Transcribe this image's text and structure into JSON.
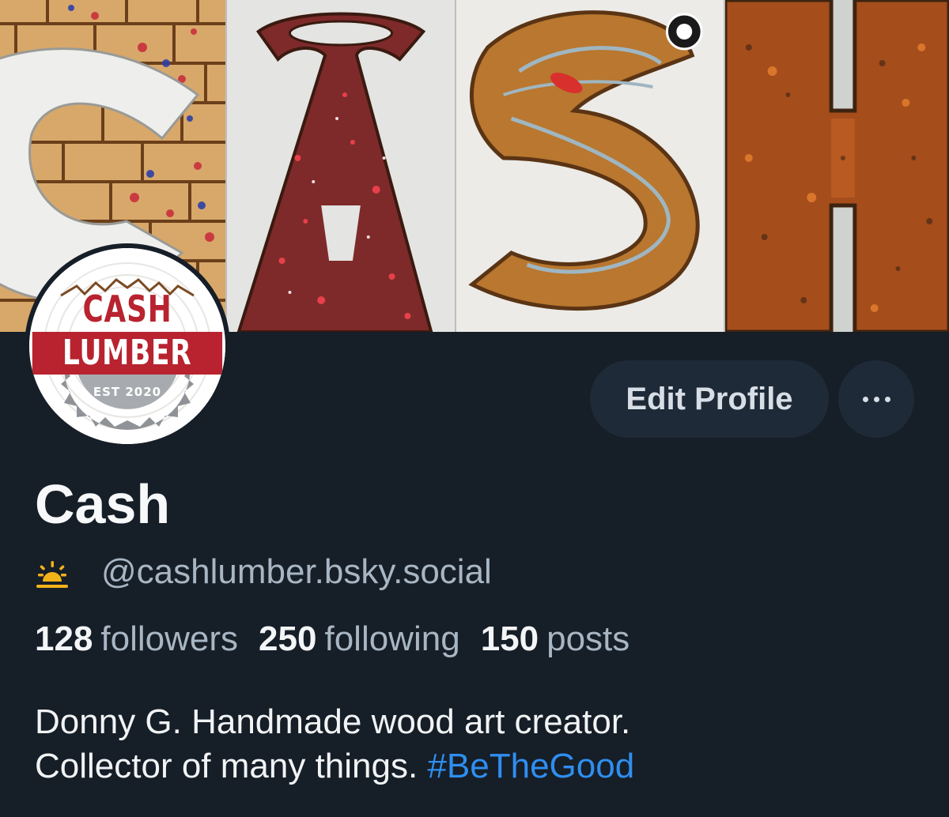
{
  "banner": {
    "letters": [
      "C",
      "A",
      "S",
      "H"
    ]
  },
  "avatar": {
    "line1": "CASH",
    "line2": "LUMBER",
    "line3": "EST 2020"
  },
  "actions": {
    "edit_label": "Edit Profile",
    "more_icon": "ellipsis-icon"
  },
  "profile": {
    "display_name": "Cash",
    "handle": "@cashlumber.bsky.social",
    "handle_icon": "sunrise-icon",
    "icon_color": "#f2b21a"
  },
  "stats": {
    "followers": {
      "value": "128",
      "label": "followers"
    },
    "following": {
      "value": "250",
      "label": "following"
    },
    "posts": {
      "value": "150",
      "label": "posts"
    }
  },
  "bio": {
    "line1": "Donny G. Handmade wood art creator.",
    "line2_text": "Collector of many things. ",
    "hashtag": "#BeTheGood",
    "hashtag_color": "#2f8ef0"
  },
  "colors": {
    "background": "#161e27",
    "button_bg": "#1e2a37",
    "muted_text": "#a8b6c4",
    "brand_red": "#b8232f"
  }
}
